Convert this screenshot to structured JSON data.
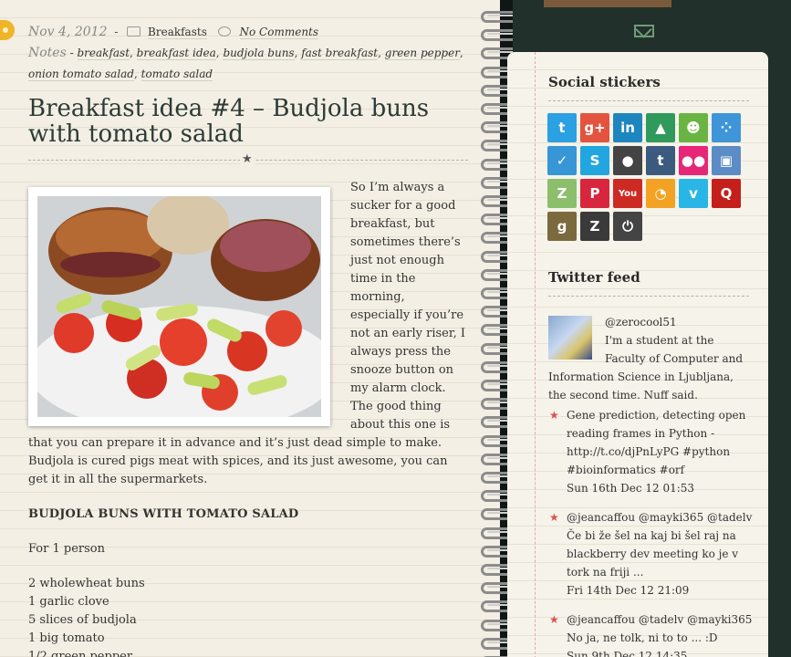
{
  "post": {
    "date": "Nov 4, 2012",
    "date_sep": "-",
    "category": "Breakfasts",
    "comments": "No Comments",
    "notes_label": "Notes",
    "notes_sep": "-",
    "tags": [
      "breakfast",
      "breakfast idea",
      "budjola buns",
      "fast breakfast",
      "green pepper",
      "onion tomato salad",
      "tomato salad"
    ],
    "title": "Breakfast idea #4 – Budjola buns with tomato salad",
    "divider_glyph": "★",
    "intro": "So I’m always a sucker for a good breakfast, but sometimes there’s just not enough time in the morning, especially if you’re not an early riser, I always press the snooze button on my alarm clock. The good thing about this one is that you can prepare it in advance and it’s just dead simple to make. Budjola is cured pigs meat with spices, and its just awesome, you can get it in all the supermarkets.",
    "recipe_heading": "BUDJOLA BUNS WITH TOMATO SALAD",
    "servings": "For 1 person",
    "ingredients": [
      "2 wholewheat buns",
      "1 garlic clove",
      "5 slices of budjola",
      "1 big tomato",
      "1/2 green pepper"
    ]
  },
  "sidebar": {
    "social_title": "Social stickers",
    "stickers": [
      {
        "icon": "twitter-icon",
        "glyph": "t",
        "color": "#2ba0e3"
      },
      {
        "icon": "google-plus-icon",
        "glyph": "g+",
        "color": "#e2543f"
      },
      {
        "icon": "linkedin-icon",
        "glyph": "in",
        "color": "#1e86bf"
      },
      {
        "icon": "tree-icon",
        "glyph": "▲",
        "color": "#2f9a5b"
      },
      {
        "icon": "stumble-icon",
        "glyph": "☻",
        "color": "#6ab444"
      },
      {
        "icon": "dots-icon",
        "glyph": "⁘",
        "color": "#3e96d8"
      },
      {
        "icon": "check-icon",
        "glyph": "✓",
        "color": "#3796d6"
      },
      {
        "icon": "skype-icon",
        "glyph": "S",
        "color": "#22a6e0"
      },
      {
        "icon": "github-icon",
        "glyph": "●",
        "color": "#444444"
      },
      {
        "icon": "tumblr-icon",
        "glyph": "t",
        "color": "#3c5a7d"
      },
      {
        "icon": "flickr-icon",
        "glyph": "●●",
        "color": "#e62677"
      },
      {
        "icon": "instagram-icon",
        "glyph": "▣",
        "color": "#5b8cc5"
      },
      {
        "icon": "zerply-icon",
        "glyph": "Z",
        "color": "#8cbf6c"
      },
      {
        "icon": "pinterest-icon",
        "glyph": "P",
        "color": "#d7263d"
      },
      {
        "icon": "youtube-icon",
        "glyph": "You",
        "color": "#cc2a22"
      },
      {
        "icon": "loop-icon",
        "glyph": "◔",
        "color": "#f3a223"
      },
      {
        "icon": "vimeo-icon",
        "glyph": "v",
        "color": "#29b6e7"
      },
      {
        "icon": "quora-icon",
        "glyph": "Q",
        "color": "#c41f1b"
      },
      {
        "icon": "goodreads-icon",
        "glyph": "g",
        "color": "#7c6a3f"
      },
      {
        "icon": "zootool-icon",
        "glyph": "Z",
        "color": "#3a3a3a"
      },
      {
        "icon": "power-icon",
        "glyph": "⏻",
        "color": "#444444"
      }
    ],
    "twitter_title": "Twitter feed",
    "profile_handle": "@zerocool51",
    "profile_bio": "I'm a student at the Faculty of Computer and Information Science in Ljubljana, the second time. Nuff said.",
    "tweets": [
      {
        "text": "Gene prediction, detecting open reading frames in Python - http://t.co/djPnLyPG #python #bioinformatics #orf",
        "time": "Sun 16th Dec 12 01:53"
      },
      {
        "text": "@jeancaffou @mayki365 @tadelv Če bi že šel na kaj bi šel raj na blackberry dev meeting ko je v tork na friji ...",
        "time": "Fri 14th Dec 12 21:09"
      },
      {
        "text": "@jeancaffou @tadelv @mayki365 No ja, ne tolk, ni to to ... :D",
        "time": "Sun 9th Dec 12 14:35"
      }
    ]
  }
}
